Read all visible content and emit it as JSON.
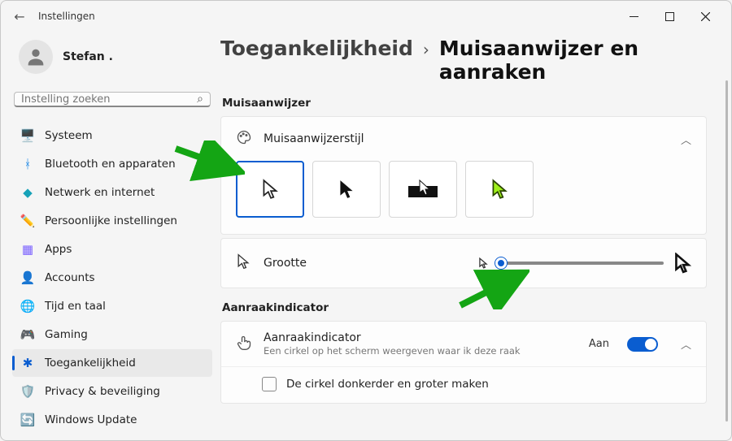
{
  "window": {
    "title": "Instellingen"
  },
  "user": {
    "name": "Stefan ."
  },
  "search": {
    "placeholder": "Instelling zoeken"
  },
  "nav": {
    "items": [
      {
        "key": "system",
        "label": "Systeem",
        "icon": "🖥️",
        "color": "#1e88e5"
      },
      {
        "key": "bt",
        "label": "Bluetooth en apparaten",
        "icon": "ᚼ",
        "color": "#1e88e5"
      },
      {
        "key": "net",
        "label": "Netwerk en internet",
        "icon": "◆",
        "color": "#17a2b8"
      },
      {
        "key": "personal",
        "label": "Persoonlijke instellingen",
        "icon": "✏️",
        "color": "#d97d3b"
      },
      {
        "key": "apps",
        "label": "Apps",
        "icon": "▦",
        "color": "#7b61ff"
      },
      {
        "key": "accounts",
        "label": "Accounts",
        "icon": "👤",
        "color": "#d97d3b"
      },
      {
        "key": "time",
        "label": "Tijd en taal",
        "icon": "🌐",
        "color": "#444"
      },
      {
        "key": "gaming",
        "label": "Gaming",
        "icon": "🎮",
        "color": "#777"
      },
      {
        "key": "access",
        "label": "Toegankelijkheid",
        "icon": "✱",
        "color": "#0a5dd0"
      },
      {
        "key": "privacy",
        "label": "Privacy & beveiliging",
        "icon": "🛡️",
        "color": "#777"
      },
      {
        "key": "update",
        "label": "Windows Update",
        "icon": "🔄",
        "color": "#1e88e5"
      }
    ],
    "active": "access"
  },
  "breadcrumb": {
    "parent": "Toegankelijkheid",
    "current": "Muisaanwijzer en aanraken"
  },
  "sections": {
    "pointer_label": "Muisaanwijzer",
    "touch_label": "Aanraakindicator"
  },
  "pointer_style": {
    "label": "Muisaanwijzerstijl",
    "selected": 0,
    "options": [
      "white-outline",
      "black-solid",
      "black-inverted",
      "custom-green"
    ]
  },
  "size": {
    "label": "Grootte",
    "value": 1,
    "min": 1,
    "max": 15
  },
  "touch_indicator": {
    "title": "Aanraakindicator",
    "subtitle": "Een cirkel op het scherm weergeven waar ik deze raak",
    "state_label": "Aan",
    "enabled": true,
    "darker_label": "De cirkel donkerder en groter maken",
    "darker_checked": false
  }
}
